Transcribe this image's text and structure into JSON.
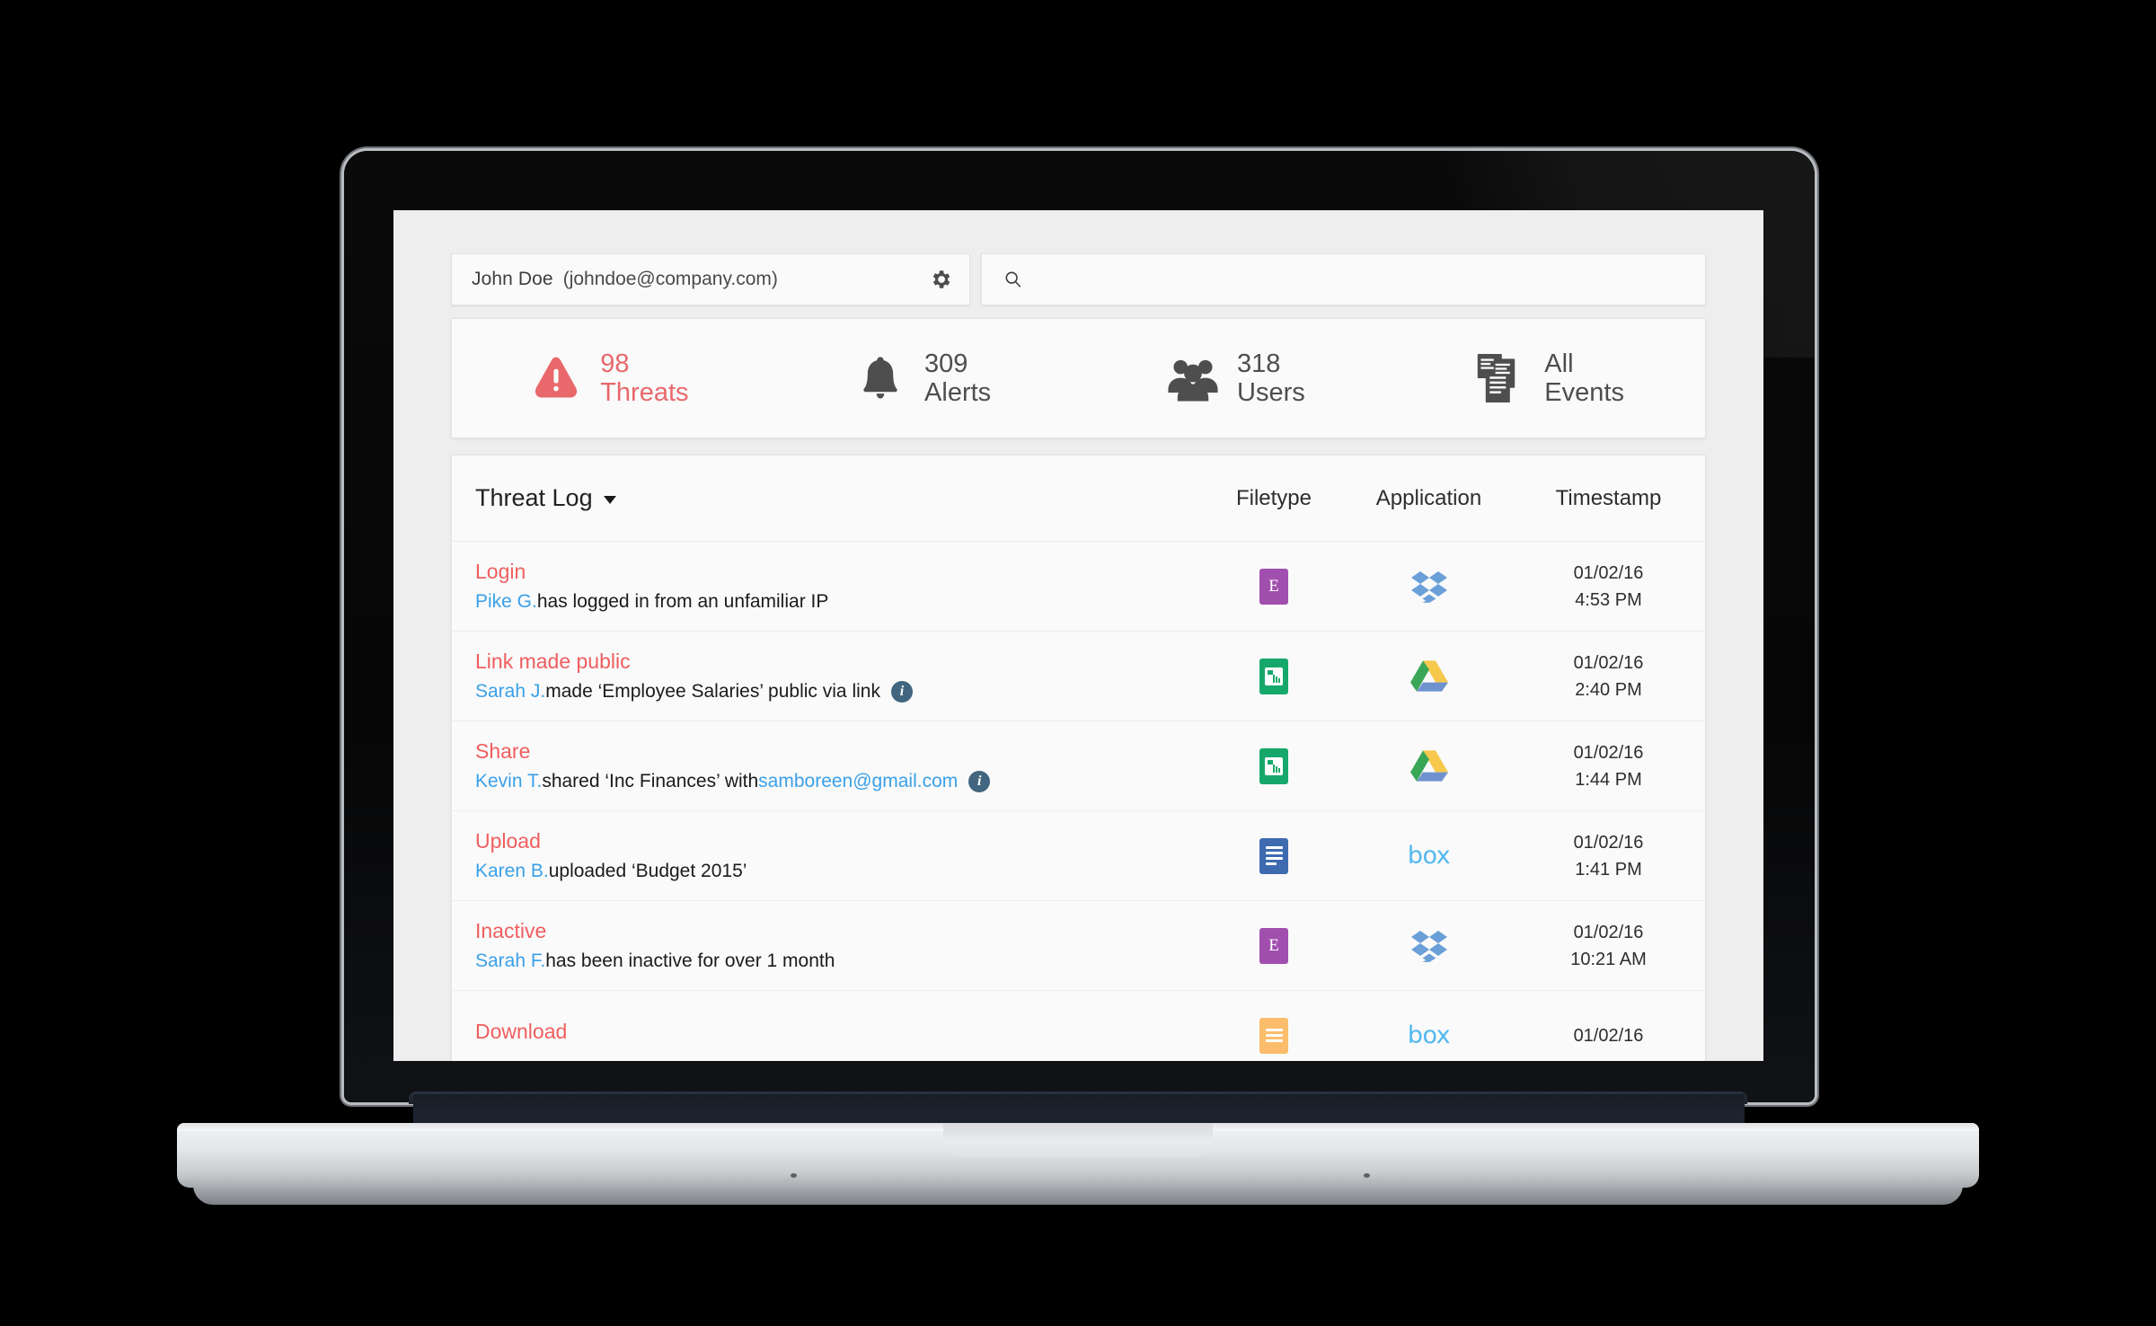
{
  "account": {
    "name": "John Doe",
    "email": "(johndoe@company.com)",
    "gear_icon": "gear-icon"
  },
  "search": {
    "value": "",
    "placeholder": "",
    "icon": "search-icon"
  },
  "stats": [
    {
      "icon": "warning-triangle-icon",
      "number": "98",
      "label": "Threats",
      "color": "#e8686c"
    },
    {
      "icon": "bell-icon",
      "number": "309",
      "label": "Alerts",
      "color": "#4e4e4e"
    },
    {
      "icon": "users-group-icon",
      "number": "318",
      "label": "Users",
      "color": "#4e4e4e"
    },
    {
      "icon": "documents-icon",
      "number": "All",
      "label": "Events",
      "color": "#4e4e4e"
    }
  ],
  "table": {
    "title": "Threat Log",
    "sort_icon": "caret-down-icon",
    "columns": {
      "filetype": "Filetype",
      "application": "Application",
      "timestamp": "Timestamp"
    },
    "rows": [
      {
        "kind": "Login",
        "actor": "Pike G.",
        "text_before": " has logged in from an unfamiliar IP",
        "link": "",
        "text_after": "",
        "info": false,
        "filetype_icon": "excel-purple-e-icon",
        "filetype_color": "#a14fae",
        "app_icon": "dropbox-icon",
        "date": "01/02/16",
        "time": "4:53 PM"
      },
      {
        "kind": "Link made public",
        "actor": "Sarah J.",
        "text_before": " made ‘Employee Salaries’ public via link",
        "link": "",
        "text_after": "",
        "info": true,
        "filetype_icon": "spreadsheet-green-icon",
        "filetype_color": "#16a86b",
        "app_icon": "google-drive-icon",
        "date": "01/02/16",
        "time": "2:40 PM"
      },
      {
        "kind": "Share",
        "actor": "Kevin T.",
        "text_before": " shared ‘Inc Finances’ with ",
        "link": "samboreen@gmail.com",
        "text_after": "",
        "info": true,
        "filetype_icon": "spreadsheet-green-icon",
        "filetype_color": "#16a86b",
        "app_icon": "google-drive-icon",
        "date": "01/02/16",
        "time": "1:44 PM"
      },
      {
        "kind": "Upload",
        "actor": "Karen B.",
        "text_before": " uploaded ‘Budget 2015’",
        "link": "",
        "text_after": "",
        "info": false,
        "filetype_icon": "document-blue-icon",
        "filetype_color": "#3e6bb0",
        "app_icon": "box-icon",
        "date": "01/02/16",
        "time": "1:41 PM"
      },
      {
        "kind": "Inactive",
        "actor": "Sarah F.",
        "text_before": " has been inactive for over 1 month",
        "link": "",
        "text_after": "",
        "info": false,
        "filetype_icon": "excel-purple-e-icon",
        "filetype_color": "#a14fae",
        "app_icon": "dropbox-icon",
        "date": "01/02/16",
        "time": "10:21 AM"
      },
      {
        "kind": "Download",
        "actor": "",
        "text_before": "",
        "link": "",
        "text_after": "",
        "info": false,
        "filetype_icon": "document-orange-icon",
        "filetype_color": "#fbbd6b",
        "app_icon": "box-icon",
        "date": "01/02/16",
        "time": ""
      }
    ]
  },
  "theme": {
    "threat_red": "#ef5e5e",
    "link_blue": "#3aa0e8",
    "page_bg": "#eeeeee",
    "panel_bg": "#fafafa"
  }
}
